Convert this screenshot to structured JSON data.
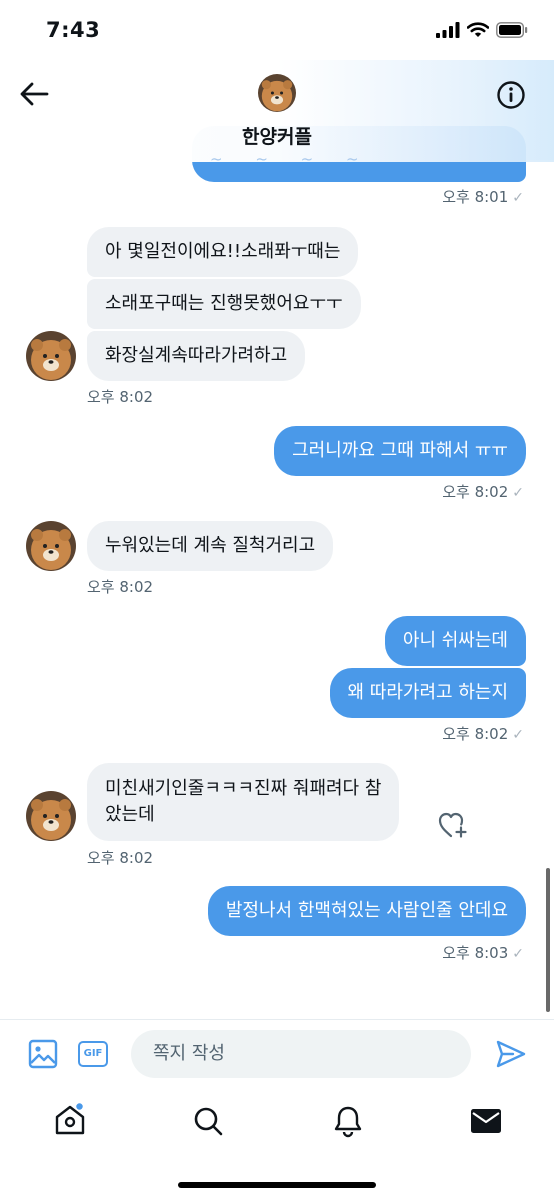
{
  "status": {
    "time": "7:43"
  },
  "header": {
    "title": "한양커플",
    "partial_text": "~ ~ ~ ~"
  },
  "messages": [
    {
      "dir": "out",
      "text": "",
      "time": "오후 8:01"
    },
    {
      "dir": "in",
      "text": "아 몇일전이에요!!소래퐈ㅜ때는"
    },
    {
      "dir": "in",
      "text": "소래포구때는 진행못했어요ㅜㅜ"
    },
    {
      "dir": "in",
      "text": "화장실계속따라가려하고",
      "time": "오후 8:02"
    },
    {
      "dir": "out",
      "text": "그러니까요 그때 파해서 ㅠㅠ",
      "time": "오후 8:02"
    },
    {
      "dir": "in",
      "text": "누워있는데 계속 질척거리고",
      "time": "오후 8:02"
    },
    {
      "dir": "out",
      "text": "아니 쉬싸는데"
    },
    {
      "dir": "out",
      "text": "왜 따라가려고 하는지",
      "time": "오후 8:02"
    },
    {
      "dir": "in",
      "text_line1": "미친새기인줄ㅋㅋㅋ진짜 줘패려다 참",
      "text_line2": "았는데",
      "time": "오후 8:02"
    },
    {
      "dir": "out",
      "text": "발정나서 한맥혀있는 사람인줄 안데요",
      "time": "오후 8:03"
    }
  ],
  "composer": {
    "placeholder": "쪽지 작성",
    "gif_label": "GIF"
  },
  "icons": {
    "back": "arrow-left-icon",
    "info": "info-icon",
    "image": "image-icon",
    "gif": "gif-icon",
    "send": "send-icon",
    "heart": "heart-plus-icon",
    "home": "home-icon",
    "search": "search-icon",
    "bell": "bell-icon",
    "mail": "mail-icon"
  },
  "colors": {
    "accent": "#4a99e9",
    "incoming_bubble": "#eef1f4",
    "timestamp": "#536471"
  }
}
